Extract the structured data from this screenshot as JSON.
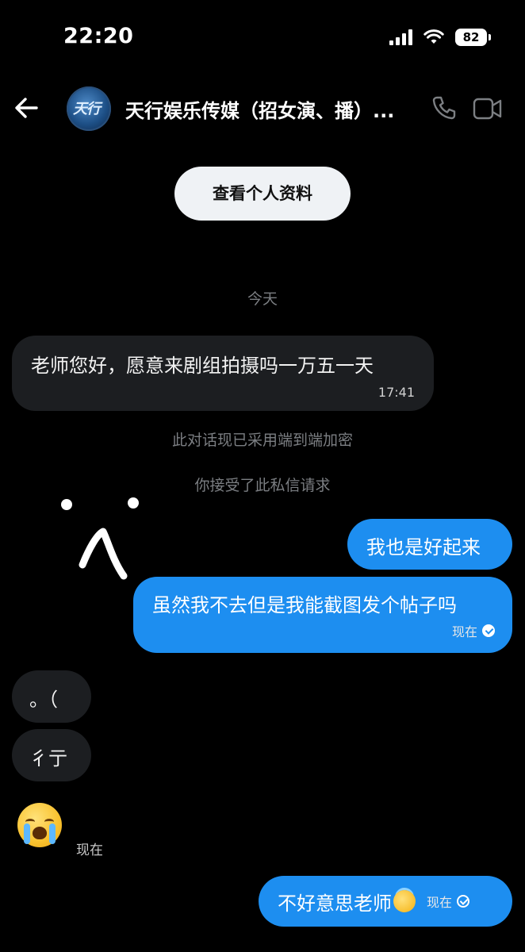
{
  "status_bar": {
    "time": "22:20",
    "battery": "82"
  },
  "header": {
    "title": "天行娱乐传媒（招女演、播）...",
    "avatar_text": "天行",
    "profile_button": "查看个人资料"
  },
  "labels": {
    "date_divider": "今天",
    "encryption_notice": "此对话现已采用端到端加密",
    "accepted_notice": "你接受了此私信请求"
  },
  "messages": [
    {
      "direction": "incoming",
      "text": "老师您好，愿意来剧组拍摄吗一万五一天",
      "time": "17:41"
    },
    {
      "direction": "outgoing",
      "text": "我也是好起来"
    },
    {
      "direction": "outgoing",
      "text": "虽然我不去但是我能截图发个帖子吗",
      "time": "现在"
    },
    {
      "direction": "incoming",
      "text": "。（"
    },
    {
      "direction": "incoming",
      "text": "彳亍"
    },
    {
      "direction": "incoming",
      "type": "emoji",
      "emoji": "loudly-crying-face",
      "time": "现在"
    },
    {
      "direction": "outgoing",
      "text": "不好意思老师",
      "emoji": "smiling-face-with-halo",
      "time": "现在"
    }
  ],
  "colors": {
    "outgoing_bubble": "#1d8ef0",
    "incoming_bubble": "#1c1e21",
    "background": "#000000"
  }
}
